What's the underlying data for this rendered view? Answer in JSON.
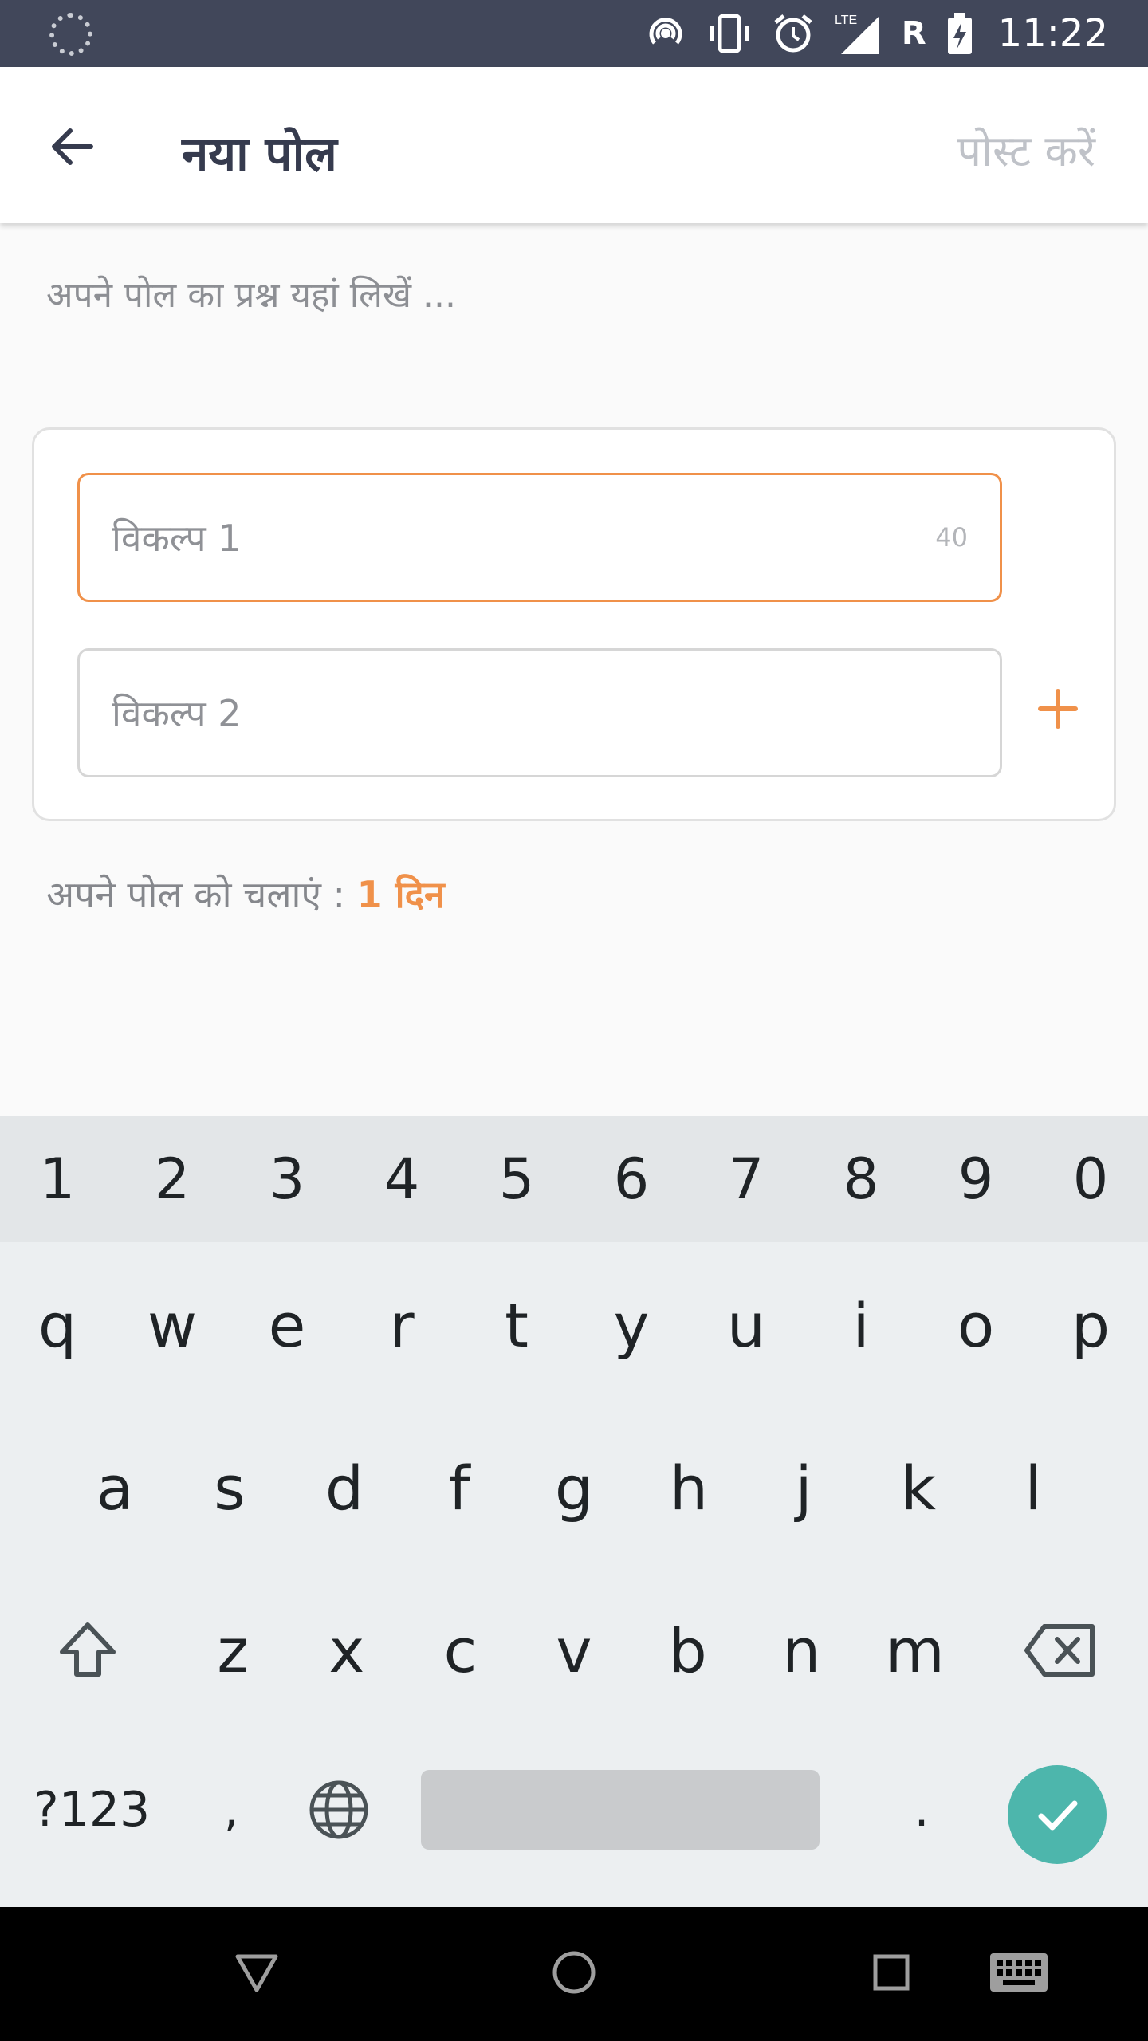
{
  "status_bar": {
    "time": "11:22",
    "roaming": "R",
    "network": "LTE",
    "icons": [
      "loading-icon",
      "hotspot-icon",
      "vibrate-icon",
      "alarm-icon",
      "signal-icon",
      "battery-charging-icon"
    ]
  },
  "app_bar": {
    "back_icon": "arrow-left-icon",
    "title": "नया पोल",
    "post_label": "पोस्ट करें"
  },
  "question": {
    "placeholder": "अपने पोल का प्रश्न यहां लिखें ..."
  },
  "options": {
    "items": [
      {
        "placeholder": "विकल्प 1",
        "counter": "40"
      },
      {
        "placeholder": "विकल्प 2"
      }
    ],
    "add_icon": "plus-icon"
  },
  "duration": {
    "label": "अपने पोल को चलाएं : ",
    "value": "1 दिन"
  },
  "keyboard": {
    "numbers": [
      "1",
      "2",
      "3",
      "4",
      "5",
      "6",
      "7",
      "8",
      "9",
      "0"
    ],
    "row1": [
      "q",
      "w",
      "e",
      "r",
      "t",
      "y",
      "u",
      "i",
      "o",
      "p"
    ],
    "row2": [
      "a",
      "s",
      "d",
      "f",
      "g",
      "h",
      "j",
      "k",
      "l"
    ],
    "row3": [
      "z",
      "x",
      "c",
      "v",
      "b",
      "n",
      "m"
    ],
    "symbols_label": "?123",
    "comma_label": ",",
    "period_label": ".",
    "shift_icon": "shift-icon",
    "backspace_icon": "backspace-icon",
    "globe_icon": "globe-icon",
    "enter_icon": "check-icon"
  },
  "nav_bar": {
    "icons": [
      "back-triangle-icon",
      "home-circle-icon",
      "recents-square-icon",
      "keyboard-icon"
    ]
  },
  "colors": {
    "accent": "#f0914a",
    "status_bar": "#41475a",
    "title": "#363b4e",
    "enter": "#4db6ac"
  }
}
